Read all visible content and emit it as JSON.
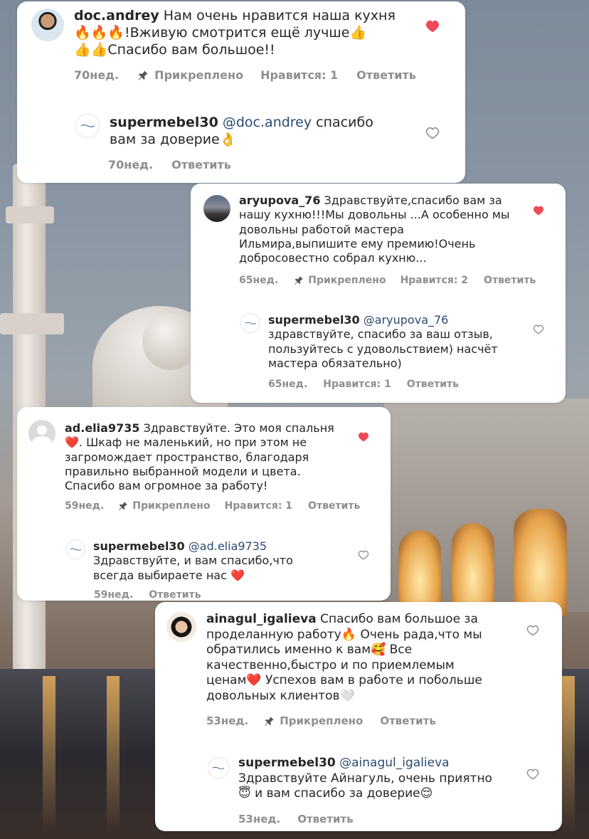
{
  "comments": [
    {
      "username": "doc.andrey",
      "text_l1": "Нам очень нравится наша кухня",
      "text_l2": "!Вживую смотрится ещё лучше",
      "text_l3": "Спасибо вам большое!!",
      "time": "70нед.",
      "pinned": "Прикреплено",
      "likes": "Нравится: 1",
      "reply": "Ответить",
      "liked": true,
      "response": {
        "username": "supermebel30",
        "mention": "@doc.andrey",
        "text_l1": "спасибо",
        "text_l2": "вам за доверие",
        "time": "70нед.",
        "reply": "Ответить"
      }
    },
    {
      "username": "aryupova_76",
      "text_l1": "Здравствуйте,спасибо вам за",
      "text_l2": "нашу кухню!!!Мы довольны ...А особенно мы",
      "text_l3": "довольны работой мастера",
      "text_l4": "Ильмира,выпишите ему премию!Очень",
      "text_l5": "добросовестно собрал кухню...",
      "time": "65нед.",
      "pinned": "Прикреплено",
      "likes": "Нравится: 2",
      "reply": "Ответить",
      "liked": true,
      "response": {
        "username": "supermebel30",
        "mention": "@aryupova_76",
        "text_l1": "здравствуйте, спасибо за ваш отзыв,",
        "text_l2": "пользуйтесь с удовольствием) насчёт",
        "text_l3": "мастера обязательно)",
        "time": "65нед.",
        "likes": "Нравится: 1",
        "reply": "Ответить"
      }
    },
    {
      "username": "ad.elia9735",
      "text_l1": "Здравствуйте. Это моя спальня",
      "text_l2": ". Шкаф не маленький, но при этом не",
      "text_l3": "загромождает пространство, благодаря",
      "text_l4": "правильно выбранной модели и цвета.",
      "text_l5": "Спасибо вам огромное за работу!",
      "time": "59нед.",
      "pinned": "Прикреплено",
      "likes": "Нравится: 1",
      "reply": "Ответить",
      "liked": true,
      "response": {
        "username": "supermebel30",
        "mention": "@ad.elia9735",
        "text_l1": "Здравствуйте, и вам спасибо,что",
        "text_l2": "всегда выбираете нас",
        "time": "59нед.",
        "reply": "Ответить"
      }
    },
    {
      "username": "ainagul_igalieva",
      "text_l1": "Спасибо вам большое за",
      "text_l2": "проделанную работу",
      "text_l2b": "Очень рада,что мы",
      "text_l3": "обратились именно к вам",
      "text_l3b": "Все",
      "text_l4": "качественно,быстро и по приемлемым",
      "text_l5": "ценам",
      "text_l5b": "Успехов вам в работе и побольше",
      "text_l6": "довольных клиентов",
      "time": "53нед.",
      "pinned": "Прикреплено",
      "reply": "Ответить",
      "liked": false,
      "response": {
        "username": "supermebel30",
        "mention": "@ainagul_igalieva",
        "text_l1": "Здравствуйте Айнагуль, очень приятно",
        "text_l2": "и вам спасибо за доверие",
        "time": "53нед.",
        "reply": "Ответить"
      }
    }
  ],
  "icons": {
    "heart_filled": "heart-filled-icon",
    "heart_outline": "heart-outline-icon",
    "pin": "pin-icon"
  },
  "colors": {
    "heart_red": "#ed4956",
    "meta_gray": "#8e8e8e",
    "mention_blue": "#2a4a73"
  }
}
